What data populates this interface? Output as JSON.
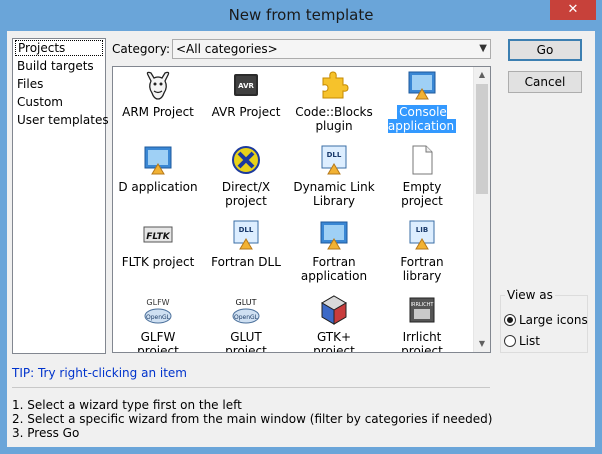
{
  "window": {
    "title": "New from template",
    "close_glyph": "✕"
  },
  "categories": {
    "items": [
      {
        "label": "Projects",
        "selected": true
      },
      {
        "label": "Build targets"
      },
      {
        "label": "Files"
      },
      {
        "label": "Custom"
      },
      {
        "label": "User templates"
      }
    ]
  },
  "filter": {
    "label": "Category:",
    "value": "<All categories>"
  },
  "templates": [
    {
      "label": "ARM Project",
      "icon": "gnu-icon"
    },
    {
      "label": "AVR Project",
      "icon": "avr-chip-icon"
    },
    {
      "label": "Code::Blocks\nplugin",
      "icon": "puzzle-plugin-icon"
    },
    {
      "label": "Console\napplication",
      "icon": "console-app-icon",
      "selected": true
    },
    {
      "label": "D application",
      "icon": "d-app-icon"
    },
    {
      "label": "Direct/X\nproject",
      "icon": "directx-icon"
    },
    {
      "label": "Dynamic Link\nLibrary",
      "icon": "dll-icon"
    },
    {
      "label": "Empty\nproject",
      "icon": "empty-file-icon"
    },
    {
      "label": "FLTK project",
      "icon": "fltk-icon"
    },
    {
      "label": "Fortran DLL",
      "icon": "fortran-dll-icon"
    },
    {
      "label": "Fortran\napplication",
      "icon": "fortran-app-icon"
    },
    {
      "label": "Fortran\nlibrary",
      "icon": "fortran-lib-icon"
    },
    {
      "label": "GLFW\nproject",
      "icon": "glfw-icon"
    },
    {
      "label": "GLUT\nproject",
      "icon": "glut-icon"
    },
    {
      "label": "GTK+\nproject",
      "icon": "gtk-icon"
    },
    {
      "label": "Irrlicht\nproject",
      "icon": "irrlicht-icon"
    }
  ],
  "glfw_caption": "GLFW",
  "glut_caption": "GLUT",
  "buttons": {
    "go": "Go",
    "cancel": "Cancel"
  },
  "view_as": {
    "title": "View as",
    "options": [
      {
        "label": "Large icons",
        "checked": true
      },
      {
        "label": "List",
        "checked": false
      }
    ]
  },
  "tip": "TIP: Try right-clicking an item",
  "steps": [
    "1. Select a wizard type first on the left",
    "2. Select a specific wizard from the main window (filter by categories if needed)",
    "3. Press Go"
  ]
}
